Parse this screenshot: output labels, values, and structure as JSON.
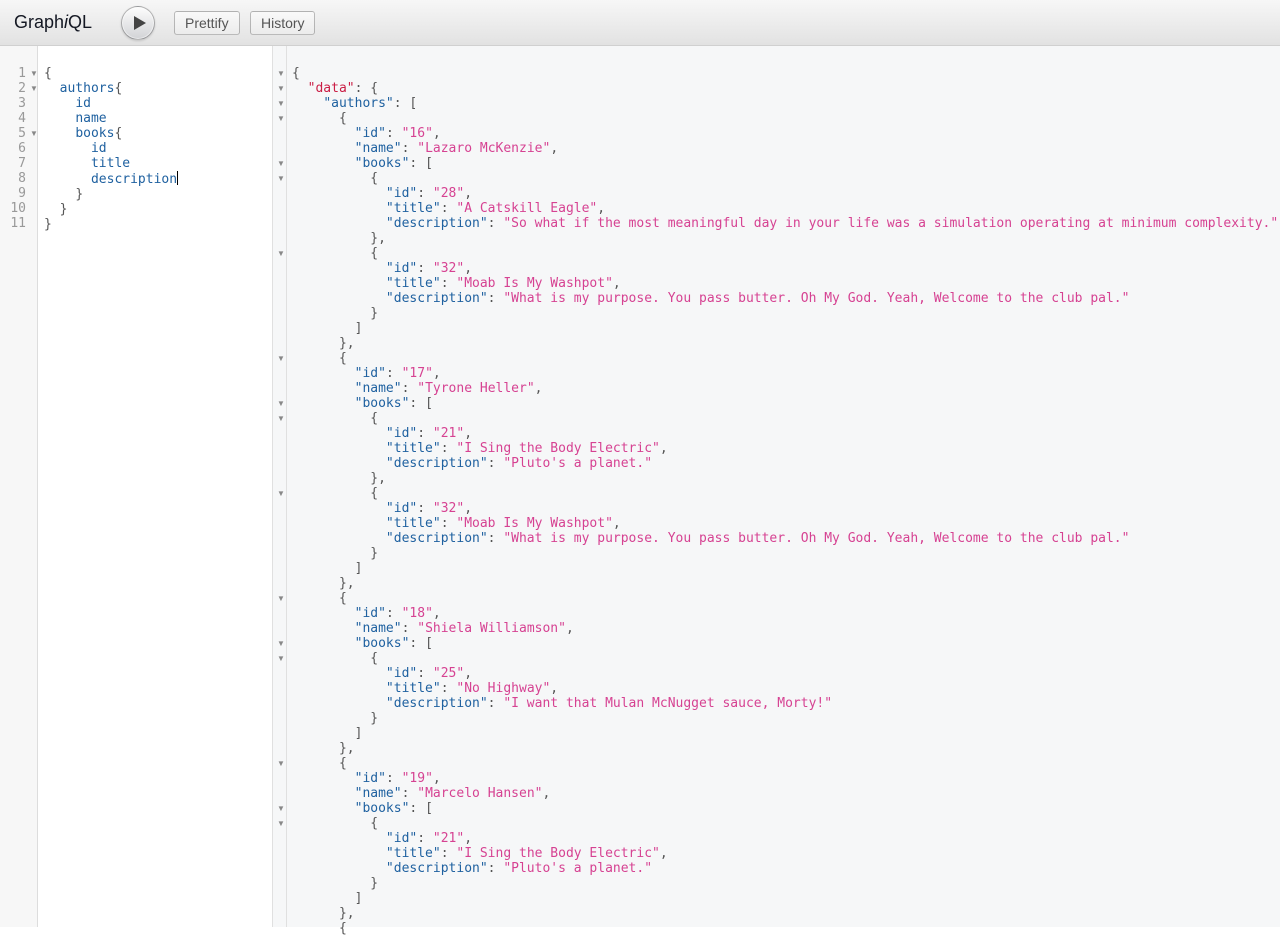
{
  "app": {
    "title_prefix": "Graph",
    "title_italic": "i",
    "title_suffix": "QL"
  },
  "toolbar": {
    "execute_icon": "play-icon",
    "prettify_label": "Prettify",
    "history_label": "History"
  },
  "query_editor": {
    "line_numbers": [
      "1",
      "2",
      "3",
      "4",
      "5",
      "6",
      "7",
      "8",
      "9",
      "10",
      "11"
    ],
    "lines": [
      {
        "indent": 0,
        "text": "{"
      },
      {
        "indent": 1,
        "text": "authors{"
      },
      {
        "indent": 2,
        "text": "id"
      },
      {
        "indent": 2,
        "text": "name"
      },
      {
        "indent": 2,
        "text": "books{"
      },
      {
        "indent": 3,
        "text": "id"
      },
      {
        "indent": 3,
        "text": "title"
      },
      {
        "indent": 3,
        "text": "description",
        "cursor": true
      },
      {
        "indent": 2,
        "text": "}"
      },
      {
        "indent": 1,
        "text": "}"
      },
      {
        "indent": 0,
        "text": "}"
      }
    ],
    "fold_lines": [
      1,
      2,
      5
    ]
  },
  "result": {
    "root_key": "data",
    "list_key": "authors",
    "authors": [
      {
        "id": "16",
        "name": "Lazaro McKenzie",
        "books": [
          {
            "id": "28",
            "title": "A Catskill Eagle",
            "description": "So what if the most meaningful day in your life was a simulation operating at minimum complexity."
          },
          {
            "id": "32",
            "title": "Moab Is My Washpot",
            "description": "What is my purpose. You pass butter. Oh My God. Yeah, Welcome to the club pal."
          }
        ]
      },
      {
        "id": "17",
        "name": "Tyrone Heller",
        "books": [
          {
            "id": "21",
            "title": "I Sing the Body Electric",
            "description": "Pluto's a planet."
          },
          {
            "id": "32",
            "title": "Moab Is My Washpot",
            "description": "What is my purpose. You pass butter. Oh My God. Yeah, Welcome to the club pal."
          }
        ]
      },
      {
        "id": "18",
        "name": "Shiela Williamson",
        "books": [
          {
            "id": "25",
            "title": "No Highway",
            "description": "I want that Mulan McNugget sauce, Morty!"
          }
        ]
      },
      {
        "id": "19",
        "name": "Marcelo Hansen",
        "books": [
          {
            "id": "21",
            "title": "I Sing the Body Electric",
            "description": "Pluto's a planet."
          }
        ]
      }
    ],
    "trailing": "{"
  }
}
